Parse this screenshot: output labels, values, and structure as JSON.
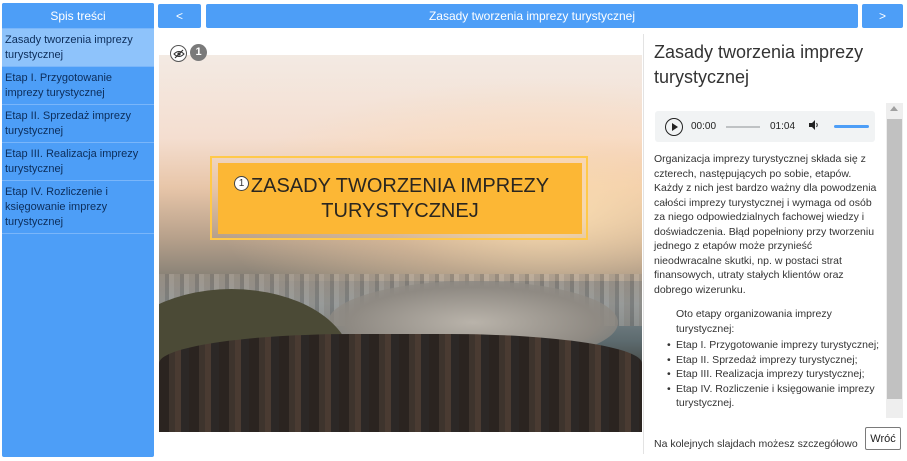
{
  "sidebar": {
    "header": "Spis treści",
    "items": [
      {
        "label": "Zasady tworzenia imprezy turystycznej",
        "active": true
      },
      {
        "label": "Etap I. Przygotowanie imprezy turystycznej",
        "active": false
      },
      {
        "label": "Etap II. Sprzedaż imprezy turystycznej",
        "active": false
      },
      {
        "label": "Etap III. Realizacja imprezy turystycznej",
        "active": false
      },
      {
        "label": "Etap IV. Rozliczenie i księgowanie imprezy turystycznej",
        "active": false
      }
    ]
  },
  "nav": {
    "prev_label": "<",
    "title": "Zasady tworzenia imprezy turystycznej",
    "next_label": ">"
  },
  "image": {
    "card_title": "ZASADY TWORZENIA IMPREZY TURYSTYCZNEJ",
    "card_marker": "1",
    "hotspot_count": "1",
    "eye_icon": "eye-off-icon"
  },
  "panel": {
    "heading": "Zasady tworzenia imprezy turystycznej",
    "audio": {
      "current_time": "00:00",
      "duration": "01:04",
      "progress": 0,
      "volume": 1.0
    },
    "intro_paragraph": "Organizacja imprezy turystycznej składa się z czterech, następujących po sobie, etapów. Każdy z nich jest bardzo ważny dla powodzenia całości imprezy turystycznej i wymaga od osób za niego odpowiedzialnych fachowej wiedzy i doświadczenia. Błąd popełniony przy tworzeniu jednego z etapów może przynieść nieodwracalne skutki, np. w postaci strat finansowych, utraty stałych klientów oraz dobrego wizerunku.",
    "list_intro": "Oto etapy organizowania imprezy turystycznej:",
    "steps": [
      "Etap I. Przygotowanie imprezy turystycznej;",
      "Etap II. Sprzedaż imprezy turystycznej;",
      "Etap III. Realizacja imprezy turystycznej;",
      "Etap IV. Rozliczenie i księgowanie imprezy turystycznej."
    ],
    "footer_text": "Na kolejnych slajdach możesz szczegółowo",
    "back_label": "Wróć"
  },
  "colors": {
    "accent": "#4d9ef7",
    "active_item": "#8ec3fb",
    "card": "#fcb735"
  }
}
